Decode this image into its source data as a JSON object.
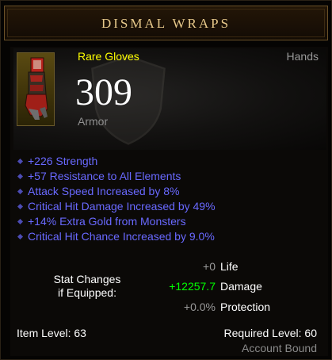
{
  "item": {
    "name": "Dismal Wraps",
    "type": "Rare Gloves",
    "slot": "Hands",
    "armor_value": "309",
    "armor_label": "Armor",
    "icon": "gloves-icon"
  },
  "affixes": [
    "+226 Strength",
    "+57 Resistance to All Elements",
    "Attack Speed Increased by 8%",
    "Critical Hit Damage Increased by 49%",
    "+14% Extra Gold from Monsters",
    "Critical Hit Chance Increased by 9.0%"
  ],
  "stat_changes": {
    "title_line1": "Stat Changes",
    "title_line2": "if Equipped:",
    "rows": [
      {
        "value": "+0",
        "name": "Life"
      },
      {
        "value": "+12257.7",
        "name": "Damage"
      },
      {
        "value": "+0.0%",
        "name": "Protection"
      }
    ]
  },
  "footer": {
    "item_level": "Item Level: 63",
    "required_level": "Required Level: 60",
    "bound": "Account Bound"
  },
  "colors": {
    "title": "#e7c98b",
    "rare": "#ffff00",
    "affix": "#6969ff",
    "positive_change": "#00ff00",
    "neutral_change": "#9a9a9a"
  }
}
